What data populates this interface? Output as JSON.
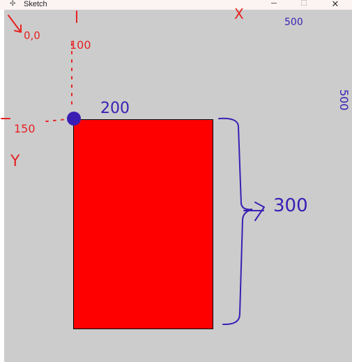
{
  "window": {
    "title": "Sketch",
    "app_icon": "processing-sketch-icon",
    "controls": {
      "minimize": "─",
      "maximize": "☐",
      "close": "✕"
    }
  },
  "canvas": {
    "background": "#cccccc"
  },
  "shape": {
    "fill": "#ff0000",
    "stroke": "#000000"
  },
  "annotations": {
    "origin": "0,0",
    "x_axis": "X",
    "y_axis": "Y",
    "x_offset": "100",
    "y_offset": "150",
    "rect_width": "200",
    "rect_height": "300",
    "canvas_width": "500",
    "canvas_height": "500",
    "red_ink": "#e62222",
    "blue_ink": "#3a1eb4"
  }
}
